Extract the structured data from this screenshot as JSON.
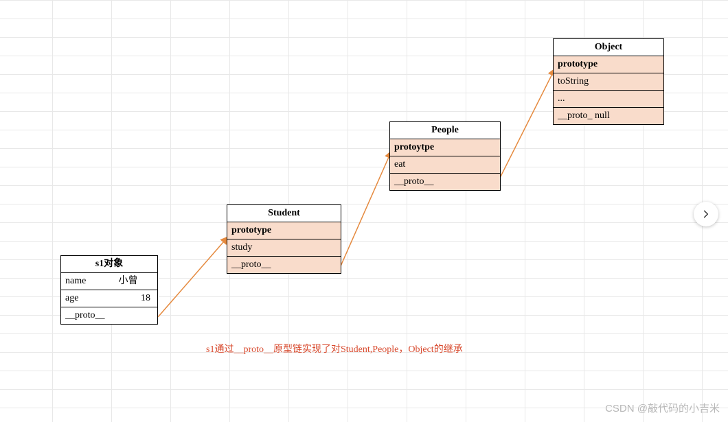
{
  "s1": {
    "title": "s1对象",
    "name_key": "name",
    "name_val": "小曾",
    "age_key": "age",
    "age_val": "18",
    "proto": "__proto__"
  },
  "student": {
    "title": "Student",
    "proto_label": "prototype",
    "method": "study",
    "proto": "__proto__"
  },
  "people": {
    "title": "People",
    "proto_label": "protoytpe",
    "method": "eat",
    "proto": "__proto__"
  },
  "object": {
    "title": "Object",
    "proto_label": "prototype",
    "method": "toString",
    "ellipsis": "...",
    "proto": "__proto_ null"
  },
  "caption": "s1通过__proto__原型链实现了对Student,People，Object的继承",
  "watermark": "CSDN @敲代码的小吉米"
}
